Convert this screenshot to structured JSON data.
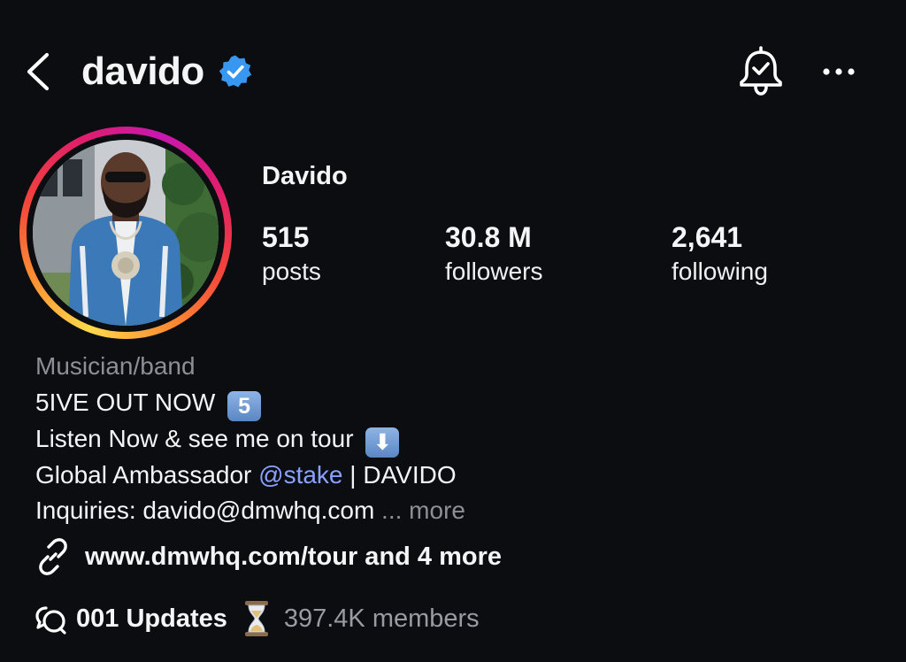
{
  "header": {
    "username": "davido",
    "back_icon": "chevron-left-icon",
    "verified_icon": "verified-badge-icon",
    "verified_color": "#3897f0",
    "notification_icon": "bell-check-icon",
    "more_icon": "more-horizontal-icon"
  },
  "profile": {
    "display_name": "Davido",
    "avatar": "profile-photo",
    "stats": [
      {
        "value": "515",
        "label": "posts"
      },
      {
        "value": "30.8 M",
        "label": "followers"
      },
      {
        "value": "2,641",
        "label": "following"
      }
    ]
  },
  "bio": {
    "category": "Musician/band",
    "line1": "5IVE OUT NOW",
    "line1_emoji": "5",
    "line2": "Listen Now & see me on tour",
    "line2_emoji": "⬇",
    "line3_prefix": "Global Ambassador",
    "line3_mention": "@stake",
    "line3_suffix": "| DAVIDO",
    "line4": "Inquiries: davido@dmwhq.com",
    "ellipsis": "...",
    "more": "more",
    "mention_color": "#8aa2ff"
  },
  "links": {
    "icon": "link-icon",
    "text": "www.dmwhq.com/tour and 4 more"
  },
  "channel": {
    "icon": "broadcast-channel-icon",
    "updates": "001 Updates",
    "hourglass_icon": "hourglass-icon",
    "members": "397.4K members"
  },
  "theme": {
    "background": "#0b0d11",
    "text": "#f5f5f7",
    "secondary_text": "#8e8e96"
  }
}
